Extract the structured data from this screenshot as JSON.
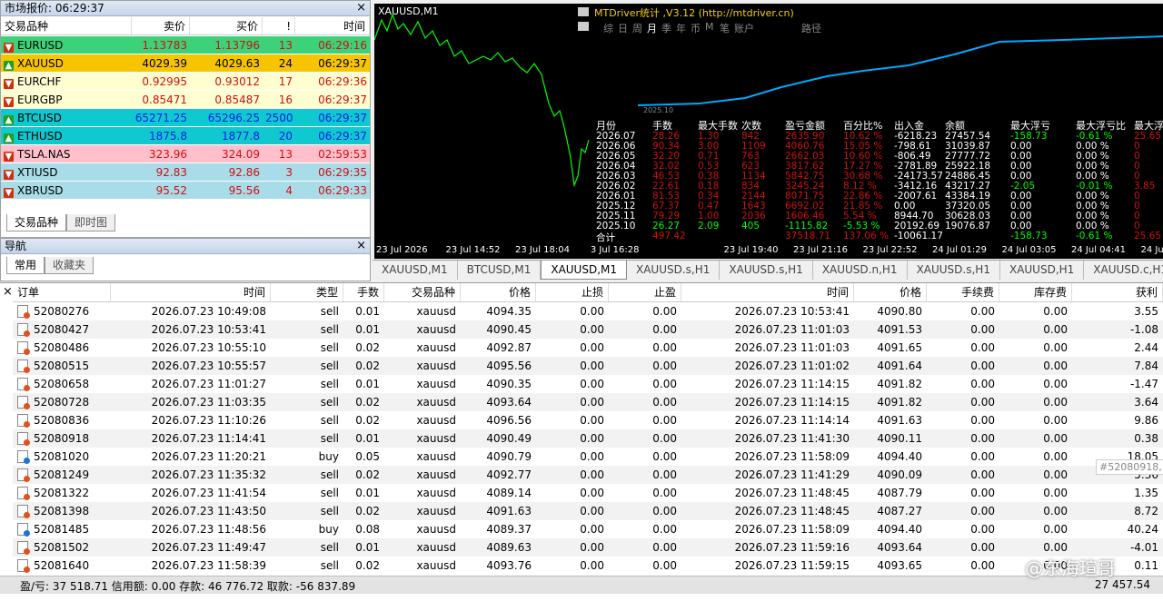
{
  "market": {
    "title": "市场报价: 06:29:37",
    "close": "×",
    "headers": [
      "交易品种",
      "卖价",
      "买价",
      "!",
      "时间"
    ],
    "rows": [
      {
        "sym": "EURUSD",
        "bid": "1.13783",
        "ask": "1.13796",
        "n": "13",
        "t": "06:29:16",
        "bg": "#3cd27a",
        "fg": "#d01010",
        "up": false
      },
      {
        "sym": "XAUUSD",
        "bid": "4029.39",
        "ask": "4029.63",
        "n": "24",
        "t": "06:29:37",
        "bg": "#f7c400",
        "fg": "#000000",
        "up": true
      },
      {
        "sym": "EURCHF",
        "bid": "0.92995",
        "ask": "0.93012",
        "n": "17",
        "t": "06:29:36",
        "bg": "#fffed0",
        "fg": "#d01010",
        "up": false
      },
      {
        "sym": "EURGBP",
        "bid": "0.85471",
        "ask": "0.85487",
        "n": "16",
        "t": "06:29:37",
        "bg": "#fffed0",
        "fg": "#d01010",
        "up": false
      },
      {
        "sym": "BTCUSD",
        "bid": "65271.25",
        "ask": "65296.25",
        "n": "2500",
        "t": "06:29:37",
        "bg": "#10c8d0",
        "fg": "#0020e0",
        "up": true
      },
      {
        "sym": "ETHUSD",
        "bid": "1875.8",
        "ask": "1877.8",
        "n": "20",
        "t": "06:29:37",
        "bg": "#10c8d0",
        "fg": "#0020e0",
        "up": true
      },
      {
        "sym": "TSLA.NAS",
        "bid": "323.96",
        "ask": "324.09",
        "n": "13",
        "t": "02:59:53",
        "bg": "#ffc0cc",
        "fg": "#d01010",
        "up": false
      },
      {
        "sym": "XTIUSD",
        "bid": "92.83",
        "ask": "92.86",
        "n": "3",
        "t": "06:29:35",
        "bg": "#a8dce8",
        "fg": "#d01010",
        "up": false
      },
      {
        "sym": "XBRUSD",
        "bid": "95.52",
        "ask": "95.56",
        "n": "4",
        "t": "06:29:33",
        "bg": "#a8dce8",
        "fg": "#d01010",
        "up": false
      }
    ],
    "tabs": [
      "交易品种",
      "即时图"
    ]
  },
  "nav": {
    "title": "导航",
    "tabs": [
      "常用",
      "收藏夹"
    ]
  },
  "chart": {
    "title": "XAUUSD,M1",
    "xlabels": [
      "23 Jul 2026",
      "23 Jul 13:16",
      "23 Jul 14:52",
      "23 Jul 16:28",
      "23 Jul 18:04",
      "23 Jul 19:40",
      "23 Jul 21:16",
      "23 Jul 22:52",
      "24 Jul 01:29",
      "24 Jul 03:05",
      "24 Jul 04:41",
      "24 Jul 06:"
    ]
  },
  "stats": {
    "title": "MTDriver统计 ,V3.12 (http://mtdriver.cn)",
    "periods": [
      "综",
      "日",
      "周",
      "月",
      "季",
      "年",
      "币",
      "M",
      "笔",
      "账户",
      "路径"
    ],
    "headers": [
      "月份",
      "手数",
      "最大手数",
      "次数",
      "盈亏金额",
      "百分比%",
      "出入金",
      "余额",
      "最大浮亏",
      "最大浮亏比",
      "最大浮"
    ],
    "curve_label": "2025.10",
    "rows": [
      [
        "2026.07",
        "28.26",
        "1.30",
        "842",
        "2635.90",
        "10.62 %",
        "-6218.23",
        "27457.54",
        "-158.73",
        "-0.61 %",
        "25.65"
      ],
      [
        "2026.06",
        "90.34",
        "3.00",
        "1109",
        "4060.76",
        "15.05 %",
        "-798.61",
        "31039.87",
        "0.00",
        "0.00 %",
        "0"
      ],
      [
        "2026.05",
        "32.20",
        "0.71",
        "763",
        "2662.03",
        "10.60 %",
        "-806.49",
        "27777.72",
        "0.00",
        "0.00 %",
        "0"
      ],
      [
        "2026.04",
        "32.02",
        "0.53",
        "623",
        "3817.62",
        "17.27 %",
        "-2781.89",
        "25922.18",
        "0.00",
        "0.00 %",
        "0"
      ],
      [
        "2026.03",
        "46.53",
        "0.38",
        "1134",
        "5842.75",
        "30.68 %",
        "-24173.57",
        "24886.45",
        "0.00",
        "0.00 %",
        "0"
      ],
      [
        "2026.02",
        "22.61",
        "0.18",
        "834",
        "3245.24",
        "8.12 %",
        "-3412.16",
        "43217.27",
        "-2.05",
        "-0.01 %",
        "3.85"
      ],
      [
        "2026.01",
        "81.53",
        "0.34",
        "2144",
        "8071.75",
        "22.86 %",
        "-2007.61",
        "43384.19",
        "0.00",
        "0.00 %",
        "0"
      ],
      [
        "2025.12",
        "67.37",
        "0.47",
        "1643",
        "6692.02",
        "21.85 %",
        "0.00",
        "37320.05",
        "0.00",
        "0.00 %",
        "0"
      ],
      [
        "2025.11",
        "79.29",
        "1.00",
        "2036",
        "1606.46",
        "5.54 %",
        "8944.70",
        "30628.03",
        "0.00",
        "0.00 %",
        "0"
      ],
      [
        "2025.10",
        "26.27",
        "2.09",
        "405",
        "-1115.82",
        "-5.53 %",
        "20192.69",
        "19076.87",
        "0.00",
        "0.00 %",
        "0"
      ],
      [
        "合计",
        "497.42",
        "",
        "",
        "37518.71",
        "137.06 %",
        "-10061.17",
        "",
        "-158.73",
        "-0.61 %",
        "25.65"
      ]
    ]
  },
  "chart_tabs": [
    "XAUUSD,M1",
    "BTCUSD,M1",
    "XAUUSD,M1",
    "XAUUSD.s,H1",
    "XAUUSD.s,H1",
    "XAUUSD.n,H1",
    "XAUUSD.s,H1",
    "XAUUSD,H1",
    "XAUUSD.c,H1"
  ],
  "terminal": {
    "headers": [
      "订单",
      "时间",
      "类型",
      "手数",
      "交易品种",
      "价格",
      "止损",
      "止盈",
      "时间",
      "价格",
      "手续费",
      "库存费",
      "获利"
    ],
    "rows": [
      [
        "52080276",
        "2026.07.23 10:49:08",
        "sell",
        "0.01",
        "xauusd",
        "4094.35",
        "0.00",
        "0.00",
        "2026.07.23 10:53:41",
        "4090.80",
        "0.00",
        "0.00",
        "3.55"
      ],
      [
        "52080427",
        "2026.07.23 10:53:41",
        "sell",
        "0.01",
        "xauusd",
        "4090.45",
        "0.00",
        "0.00",
        "2026.07.23 11:01:03",
        "4091.53",
        "0.00",
        "0.00",
        "-1.08"
      ],
      [
        "52080486",
        "2026.07.23 10:55:10",
        "sell",
        "0.02",
        "xauusd",
        "4092.87",
        "0.00",
        "0.00",
        "2026.07.23 11:01:03",
        "4091.65",
        "0.00",
        "0.00",
        "2.44"
      ],
      [
        "52080515",
        "2026.07.23 10:55:57",
        "sell",
        "0.02",
        "xauusd",
        "4095.56",
        "0.00",
        "0.00",
        "2026.07.23 11:01:02",
        "4091.64",
        "0.00",
        "0.00",
        "7.84"
      ],
      [
        "52080658",
        "2026.07.23 11:01:27",
        "sell",
        "0.01",
        "xauusd",
        "4090.35",
        "0.00",
        "0.00",
        "2026.07.23 11:14:15",
        "4091.82",
        "0.00",
        "0.00",
        "-1.47"
      ],
      [
        "52080728",
        "2026.07.23 11:03:35",
        "sell",
        "0.02",
        "xauusd",
        "4093.64",
        "0.00",
        "0.00",
        "2026.07.23 11:14:15",
        "4091.82",
        "0.00",
        "0.00",
        "3.64"
      ],
      [
        "52080836",
        "2026.07.23 11:10:26",
        "sell",
        "0.02",
        "xauusd",
        "4096.56",
        "0.00",
        "0.00",
        "2026.07.23 11:14:14",
        "4091.63",
        "0.00",
        "0.00",
        "9.86"
      ],
      [
        "52080918",
        "2026.07.23 11:14:41",
        "sell",
        "0.01",
        "xauusd",
        "4090.49",
        "0.00",
        "0.00",
        "2026.07.23 11:41:30",
        "4090.11",
        "0.00",
        "0.00",
        "0.38"
      ],
      [
        "52081020",
        "2026.07.23 11:20:21",
        "buy",
        "0.05",
        "xauusd",
        "4090.79",
        "0.00",
        "0.00",
        "2026.07.23 11:58:09",
        "4094.40",
        "0.00",
        "0.00",
        "18.05"
      ],
      [
        "52081249",
        "2026.07.23 11:35:32",
        "sell",
        "0.02",
        "xauusd",
        "4092.77",
        "0.00",
        "0.00",
        "2026.07.23 11:41:29",
        "4090.09",
        "0.00",
        "0.00",
        "5.36"
      ],
      [
        "52081322",
        "2026.07.23 11:41:54",
        "sell",
        "0.01",
        "xauusd",
        "4089.14",
        "0.00",
        "0.00",
        "2026.07.23 11:48:45",
        "4087.79",
        "0.00",
        "0.00",
        "1.35"
      ],
      [
        "52081398",
        "2026.07.23 11:43:50",
        "sell",
        "0.02",
        "xauusd",
        "4091.63",
        "0.00",
        "0.00",
        "2026.07.23 11:48:45",
        "4087.27",
        "0.00",
        "0.00",
        "8.72"
      ],
      [
        "52081485",
        "2026.07.23 11:48:56",
        "buy",
        "0.08",
        "xauusd",
        "4089.37",
        "0.00",
        "0.00",
        "2026.07.23 11:58:09",
        "4094.40",
        "0.00",
        "0.00",
        "40.24"
      ],
      [
        "52081502",
        "2026.07.23 11:49:47",
        "sell",
        "0.01",
        "xauusd",
        "4089.63",
        "0.00",
        "0.00",
        "2026.07.23 11:59:16",
        "4093.64",
        "0.00",
        "0.00",
        "-4.01"
      ],
      [
        "52081640",
        "2026.07.23 11:58:39",
        "sell",
        "0.02",
        "xauusd",
        "4093.76",
        "0.00",
        "0.00",
        "2026.07.23 11:59:15",
        "4093.65",
        "0.00",
        "0.00",
        "0.11"
      ]
    ],
    "footer": "盈/亏: 37 518.71  信用额: 0.00  存款: 46 776.72  取款: -56 837.89",
    "footer_total": "27 457.54"
  },
  "tooltip": "#52080918,",
  "watermark": "@东海瑄哥"
}
